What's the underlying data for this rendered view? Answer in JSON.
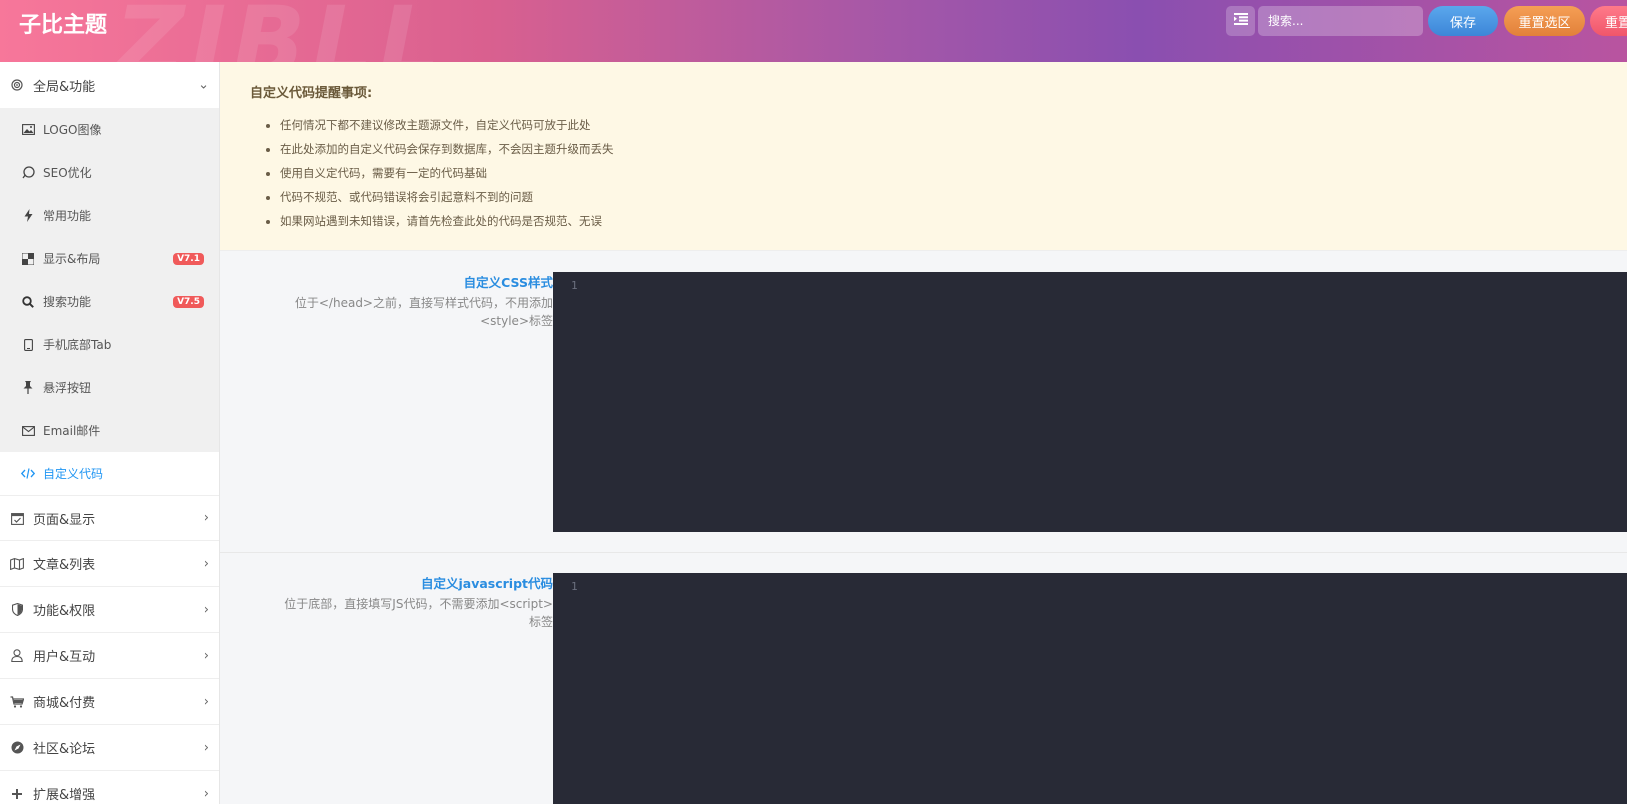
{
  "header": {
    "brand": "子比主题",
    "watermark": "ZIBLL",
    "search_placeholder": "搜索...",
    "save_label": "保存",
    "reset_section_label": "重置选区",
    "reset_all_label": "重置"
  },
  "sidebar": {
    "groups": [
      {
        "label": "全局&功能",
        "icon": "target-icon",
        "expanded": true
      },
      {
        "label": "页面&显示",
        "icon": "calendar-check-icon"
      },
      {
        "label": "文章&列表",
        "icon": "map-icon"
      },
      {
        "label": "功能&权限",
        "icon": "shield-icon"
      },
      {
        "label": "用户&互动",
        "icon": "user-icon"
      },
      {
        "label": "商城&付费",
        "icon": "cart-icon"
      },
      {
        "label": "社区&论坛",
        "icon": "compass-icon"
      },
      {
        "label": "扩展&增强",
        "icon": "plus-icon"
      }
    ],
    "sub_items": [
      {
        "label": "LOGO图像",
        "icon": "image-icon"
      },
      {
        "label": "SEO优化",
        "icon": "chat-icon"
      },
      {
        "label": "常用功能",
        "icon": "bolt-icon"
      },
      {
        "label": "显示&布局",
        "icon": "grid-icon",
        "badge": "V7.1"
      },
      {
        "label": "搜索功能",
        "icon": "search-icon",
        "badge": "V7.5"
      },
      {
        "label": "手机底部Tab",
        "icon": "mobile-icon"
      },
      {
        "label": "悬浮按钮",
        "icon": "pin-icon"
      },
      {
        "label": "Email邮件",
        "icon": "mail-icon"
      },
      {
        "label": "自定义代码",
        "icon": "code-icon",
        "active": true
      }
    ]
  },
  "notice": {
    "title": "自定义代码提醒事项:",
    "items": [
      "任何情况下都不建议修改主题源文件，自定义代码可放于此处",
      "在此处添加的自定义代码会保存到数据库，不会因主题升级而丢失",
      "使用自义定代码，需要有一定的代码基础",
      "代码不规范、或代码错误将会引起意料不到的问题",
      "如果网站遇到未知错误，请首先检查此处的代码是否规范、无误"
    ]
  },
  "fields": {
    "css": {
      "title": "自定义CSS样式",
      "desc_line1": "位于</head>之前，直接写样式代码，不用添加",
      "desc_line2": "<style>标签",
      "line_number": "1"
    },
    "js": {
      "title": "自定义javascript代码",
      "desc_line1": "位于底部，直接填写JS代码，不需要添加<script>",
      "desc_line2": "标签",
      "line_number": "1"
    }
  },
  "colors": {
    "accent": "#2196f3",
    "notice_bg": "#fef8e5",
    "editor_bg": "#282a36",
    "badge": "#f05a5a"
  }
}
